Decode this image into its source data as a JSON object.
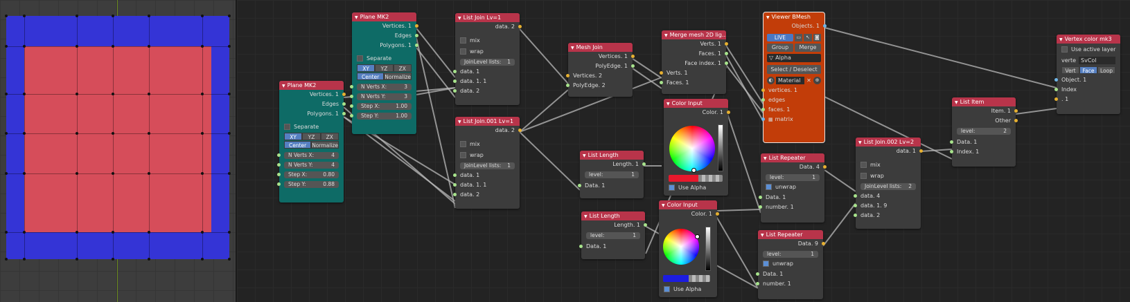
{
  "colors": {
    "plane_outer": "#3434d6",
    "plane_inner": "#d64d5a",
    "color1": "#e8182c",
    "color2": "#1c1ce0"
  },
  "nodes": {
    "plane_a": {
      "title": "Plane MK2",
      "outputs": [
        "Vertices. 1",
        "Edges",
        "Polygons. 1"
      ],
      "separate": "Separate",
      "axes": [
        "XY",
        "YZ",
        "ZX"
      ],
      "center": "Center",
      "normalize": "Normalize",
      "fields": [
        {
          "label": "N Verts X:",
          "value": "4"
        },
        {
          "label": "N Verts Y:",
          "value": "4"
        },
        {
          "label": "Step X:",
          "value": "0.80"
        },
        {
          "label": "Step Y:",
          "value": "0.88"
        }
      ]
    },
    "plane_b": {
      "title": "Plane MK2",
      "outputs": [
        "Vertices. 1",
        "Edges",
        "Polygons. 1"
      ],
      "separate": "Separate",
      "axes": [
        "XY",
        "YZ",
        "ZX"
      ],
      "center": "Center",
      "normalize": "Normalize",
      "fields": [
        {
          "label": "N Verts X:",
          "value": "3"
        },
        {
          "label": "N Verts Y:",
          "value": "3"
        },
        {
          "label": "Step X:",
          "value": "1.00"
        },
        {
          "label": "Step Y:",
          "value": "1.00"
        }
      ]
    },
    "join1": {
      "title": "List Join Lv=1",
      "output": "data. 2",
      "mix": "mix",
      "wrap": "wrap",
      "level": "JoinLevel lists:",
      "level_value": "1",
      "inputs": [
        "data. 1",
        "data. 1. 1",
        "data. 2"
      ]
    },
    "join2": {
      "title": "List Join.001 Lv=1",
      "output": "data. 2",
      "mix": "mix",
      "wrap": "wrap",
      "level": "JoinLevel lists:",
      "level_value": "1",
      "inputs": [
        "data. 1",
        "data. 1. 1",
        "data. 2"
      ]
    },
    "mesh_join": {
      "title": "Mesh Join",
      "outputs": [
        "Vertices. 1",
        "PolyEdge. 1"
      ],
      "inputs": [
        "Vertices. 2",
        "PolyEdge. 2"
      ]
    },
    "merge": {
      "title": "Merge mesh 2D lig...",
      "outputs": [
        "Verts. 1",
        "Faces. 1",
        "Face index. 1"
      ],
      "inputs": [
        "Verts. 1",
        "Faces. 1"
      ]
    },
    "len1": {
      "title": "List Length",
      "output": "Length. 1",
      "level": "level:",
      "level_value": "1",
      "input": "Data. 1"
    },
    "len2": {
      "title": "List Length",
      "output": "Length. 1",
      "level": "level:",
      "level_value": "1",
      "input": "Data. 1"
    },
    "color1": {
      "title": "Color Input",
      "output": "Color. 1",
      "alpha": "Use Alpha"
    },
    "color2": {
      "title": "Color Input",
      "output": "Color. 1",
      "alpha": "Use Alpha"
    },
    "viewer": {
      "title": "Viewer BMesh",
      "output": "Objects. 1",
      "live": "LIVE",
      "group": "Group",
      "merge": "Merge",
      "name": "Alpha",
      "select": "Select / Deselect",
      "material": "Material",
      "inputs": [
        "vertices. 1",
        "edges",
        "faces. 1",
        "matrix"
      ]
    },
    "rep1": {
      "title": "List Repeater",
      "output": "Data. 4",
      "level": "level:",
      "level_value": "1",
      "unwrap": "unwrap",
      "inputs": [
        "Data. 1",
        "number. 1"
      ]
    },
    "rep2": {
      "title": "List Repeater",
      "output": "Data. 9",
      "level": "level:",
      "level_value": "1",
      "unwrap": "unwrap",
      "inputs": [
        "Data. 1",
        "number. 1"
      ]
    },
    "join3": {
      "title": "List Join.002 Lv=2",
      "output": "data. 1",
      "mix": "mix",
      "wrap": "wrap",
      "level": "JoinLevel lists:",
      "level_value": "2",
      "inputs": [
        "data. 4",
        "data. 1. 9",
        "data. 2"
      ]
    },
    "item": {
      "title": "List Item",
      "outputs": [
        "Item. 1",
        "Other"
      ],
      "level": "level:",
      "level_value": "2",
      "inputs": [
        "Data. 1",
        "Index. 1"
      ]
    },
    "vcol": {
      "title": "Vertex color mk3",
      "use_layer": "Use active layer",
      "verte": "verte",
      "layer": "SvCol",
      "modes": [
        "Vert",
        "Face",
        "Loop"
      ],
      "inputs": [
        "Object. 1",
        "Index",
        ". 1"
      ]
    }
  }
}
